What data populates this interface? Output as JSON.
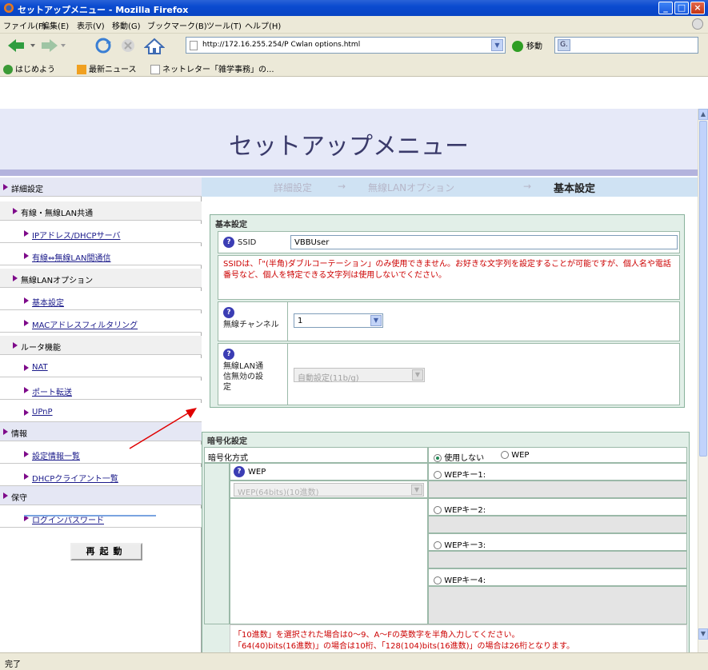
{
  "window": {
    "title": "セットアップメニュー - Mozilla Firefox",
    "min": "_",
    "max": "□",
    "close": "×"
  },
  "menubar": [
    "ファイル(F)",
    "編集(E)",
    "表示(V)",
    "移動(G)",
    "ブックマーク(B)",
    "ツール(T)",
    "ヘルプ(H)"
  ],
  "nav": {
    "url": "http://172.16.255.254/P Cwlan options.html",
    "url_dropdown": "▼",
    "go_label": "移動",
    "search_icon": "G."
  },
  "bookmarks": [
    "はじめよう",
    "最新ニュース",
    "ネットレター「雑学事務」の..."
  ],
  "page": {
    "title": "セットアップメニュー",
    "breadcrumb": {
      "b1": "詳細設定",
      "arrow": "→",
      "b2": "無線LANオプション",
      "current": "基本設定"
    }
  },
  "sidebar": {
    "items": [
      {
        "label": "詳細設定"
      },
      {
        "label": "有線・無線LAN共通"
      },
      {
        "label": "IPアドレス/DHCPサーバ"
      },
      {
        "label": "有線⇔無線LAN間通信"
      },
      {
        "label": "無線LANオプション"
      },
      {
        "label": "基本設定"
      },
      {
        "label": "MACアドレスフィルタリング"
      },
      {
        "label": "ルータ機能"
      },
      {
        "label": "NAT"
      },
      {
        "label": "ポート転送"
      },
      {
        "label": "UPnP"
      },
      {
        "label": "情報"
      },
      {
        "label": "設定情報一覧"
      },
      {
        "label": "DHCPクライアント一覧"
      },
      {
        "label": "保守"
      },
      {
        "label": "ログインパスワード"
      }
    ],
    "reboot": "再起動"
  },
  "basic": {
    "legend": "基本設定",
    "ssid_label": "SSID",
    "ssid_value": "VBBUser",
    "ssid_note": "SSIDは、「\"(半角)ダブルコーテーション」のみ使用できません。お好きな文字列を設定することが可能ですが、個人名や電話番号など、個人を特定できる文字列は使用しないでください。",
    "channel_label": "無線チャンネル",
    "channel_value": "1",
    "rate_label": "無線LAN通信無効の設定",
    "rate_value": "自動設定(11b/g)",
    "help": "?"
  },
  "encryption": {
    "legend": "暗号化設定",
    "method_label": "暗号化方式",
    "opt_none": "使用しない",
    "opt_wep": "WEP",
    "wep_label": "WEP",
    "wep_select": "WEP(64bits)(10進数)",
    "keys": [
      "WEPキー1:",
      "WEPキー2:",
      "WEPキー3:",
      "WEPキー4:"
    ],
    "note1": "「10進数」を選択された場合は0～9、A～Fの英数字を半角入力してください。",
    "note2": "「64(40)bits(16進数)」の場合は10桁、「128(104)bits(16進数)」の場合は26桁となります。"
  },
  "status": "完了",
  "annotation_color": "#e00000"
}
